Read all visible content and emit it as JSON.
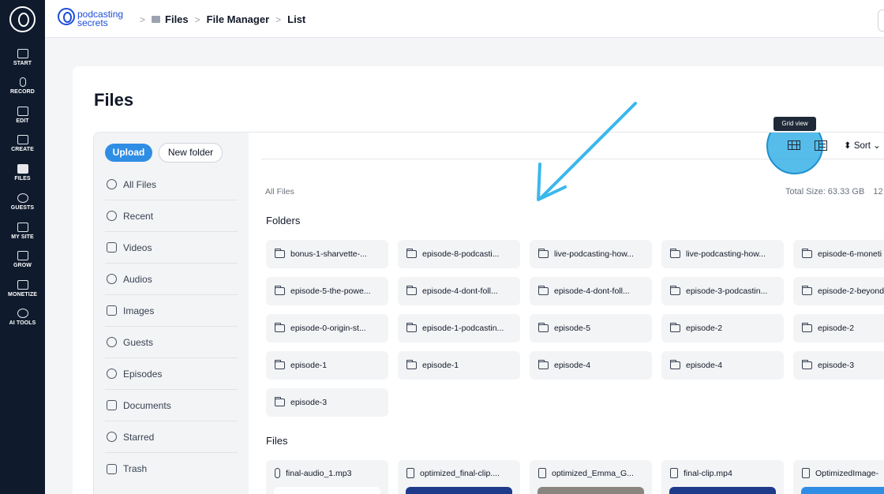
{
  "rail": {
    "items": [
      {
        "label": "START"
      },
      {
        "label": "RECORD"
      },
      {
        "label": "EDIT"
      },
      {
        "label": "CREATE"
      },
      {
        "label": "FILES"
      },
      {
        "label": "GUESTS"
      },
      {
        "label": "MY SITE"
      },
      {
        "label": "GROW"
      },
      {
        "label": "MONETIZE"
      },
      {
        "label": "AI TOOLS"
      }
    ]
  },
  "header": {
    "brand_line1": "podcasting",
    "brand_line2": "secrets",
    "breadcrumb": [
      "Files",
      "File Manager",
      "List"
    ]
  },
  "page": {
    "title": "Files"
  },
  "sidebar": {
    "upload_label": "Upload",
    "new_folder_label": "New folder",
    "items": [
      {
        "label": "All Files",
        "icon": "all-files-icon"
      },
      {
        "label": "Recent",
        "icon": "clock-icon"
      },
      {
        "label": "Videos",
        "icon": "video-icon"
      },
      {
        "label": "Audios",
        "icon": "music-note-icon"
      },
      {
        "label": "Images",
        "icon": "image-icon"
      },
      {
        "label": "Guests",
        "icon": "users-icon"
      },
      {
        "label": "Episodes",
        "icon": "episode-icon"
      },
      {
        "label": "Documents",
        "icon": "document-icon"
      },
      {
        "label": "Starred",
        "icon": "star-icon"
      },
      {
        "label": "Trash",
        "icon": "trash-icon"
      }
    ]
  },
  "toolbar": {
    "tooltip": "Grid view",
    "sort_label": "⬍ Sort ⌄"
  },
  "content": {
    "location": "All Files",
    "total_size": "Total Size: 63.33 GB",
    "total_size_suffix": "12",
    "folders_title": "Folders",
    "files_title": "Files",
    "folders": [
      "bonus-1-sharvette-...",
      "episode-8-podcasti...",
      "live-podcasting-how...",
      "live-podcasting-how...",
      "episode-6-moneti",
      "episode-5-the-powe...",
      "episode-4-dont-foll...",
      "episode-4-dont-foll...",
      "episode-3-podcastin...",
      "episode-2-beyond",
      "episode-0-origin-st...",
      "episode-1-podcastin...",
      "episode-5",
      "episode-2",
      "episode-2",
      "episode-1",
      "episode-1",
      "episode-4",
      "episode-4",
      "episode-3",
      "episode-3"
    ],
    "files": [
      {
        "name": "final-audio_1.mp3",
        "icon": "microphone-icon"
      },
      {
        "name": "optimized_final-clip....",
        "icon": "video-file-icon"
      },
      {
        "name": "optimized_Emma_G...",
        "icon": "video-file-icon"
      },
      {
        "name": "final-clip.mp4",
        "icon": "video-file-icon"
      },
      {
        "name": "OptimizedImage-",
        "icon": "image-file-icon"
      }
    ]
  },
  "colors": {
    "rail_bg": "#0f1b2d",
    "accent": "#2f8de4",
    "highlight": "#38b0e6"
  }
}
